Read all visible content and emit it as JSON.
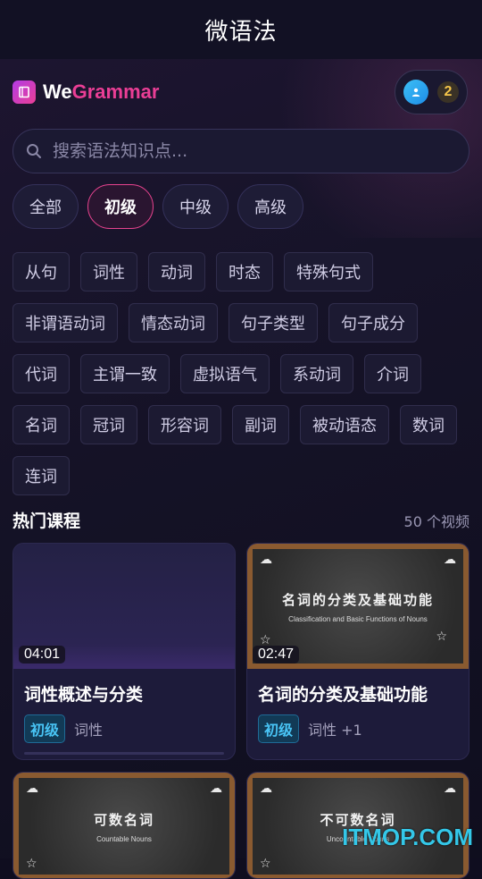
{
  "window": {
    "title": "微语法"
  },
  "brand": {
    "we": "We",
    "grammar": "Grammar",
    "icon": "book-icon"
  },
  "user": {
    "avatar_icon": "user-icon",
    "count": "2"
  },
  "search": {
    "placeholder": "搜索语法知识点...",
    "value": ""
  },
  "levels": [
    {
      "label": "全部",
      "active": false
    },
    {
      "label": "初级",
      "active": true
    },
    {
      "label": "中级",
      "active": false
    },
    {
      "label": "高级",
      "active": false
    }
  ],
  "tags": [
    "从句",
    "词性",
    "动词",
    "时态",
    "特殊句式",
    "非谓语动词",
    "情态动词",
    "句子类型",
    "句子成分",
    "代词",
    "主谓一致",
    "虚拟语气",
    "系动词",
    "介词",
    "名词",
    "冠词",
    "形容词",
    "副词",
    "被动语态",
    "数词",
    "连词"
  ],
  "section": {
    "title": "热门课程",
    "count": "50 个视频"
  },
  "courses": [
    {
      "title": "词性概述与分类",
      "duration": "04:01",
      "level": "初级",
      "category": "词性",
      "thumb_title": "",
      "thumb_sub": ""
    },
    {
      "title": "名词的分类及基础功能",
      "duration": "02:47",
      "level": "初级",
      "category": "词性 +1",
      "thumb_title": "名词的分类及基础功能",
      "thumb_sub": "Classification and Basic Functions of Nouns"
    },
    {
      "thumb_title": "可数名词",
      "thumb_sub": "Countable Nouns"
    },
    {
      "thumb_title": "不可数名词",
      "thumb_sub": "Uncountable Nouns"
    }
  ],
  "watermark": "ITMOP.COM",
  "colors": {
    "accent": "#ea3e95",
    "badge": "#48c4f5",
    "gold": "#f5c64a"
  }
}
